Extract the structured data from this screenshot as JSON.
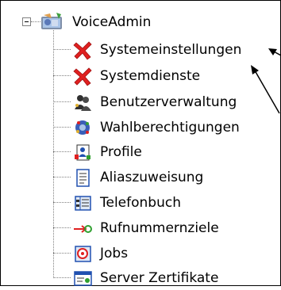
{
  "tree": {
    "root": {
      "label": "VoiceAdmin",
      "icon": "voiceadmin-icon",
      "expanded": true
    },
    "items": [
      {
        "label": "Systemeinstellungen",
        "icon": "red-x-icon"
      },
      {
        "label": "Systemdienste",
        "icon": "red-x-icon"
      },
      {
        "label": "Benutzerverwaltung",
        "icon": "users-icon"
      },
      {
        "label": "Wahlberechtigungen",
        "icon": "dial-permissions-icon"
      },
      {
        "label": "Profile",
        "icon": "profile-icon"
      },
      {
        "label": "Aliaszuweisung",
        "icon": "alias-document-icon"
      },
      {
        "label": "Telefonbuch",
        "icon": "phonebook-icon"
      },
      {
        "label": "Rufnummernziele",
        "icon": "arrow-target-icon"
      },
      {
        "label": "Jobs",
        "icon": "jobs-icon"
      },
      {
        "label": "Server Zertifikate",
        "icon": "certificate-icon"
      }
    ]
  },
  "colors": {
    "error_red": "#e02020",
    "tree_lines": "#808080",
    "icon_blue": "#2050b0"
  }
}
